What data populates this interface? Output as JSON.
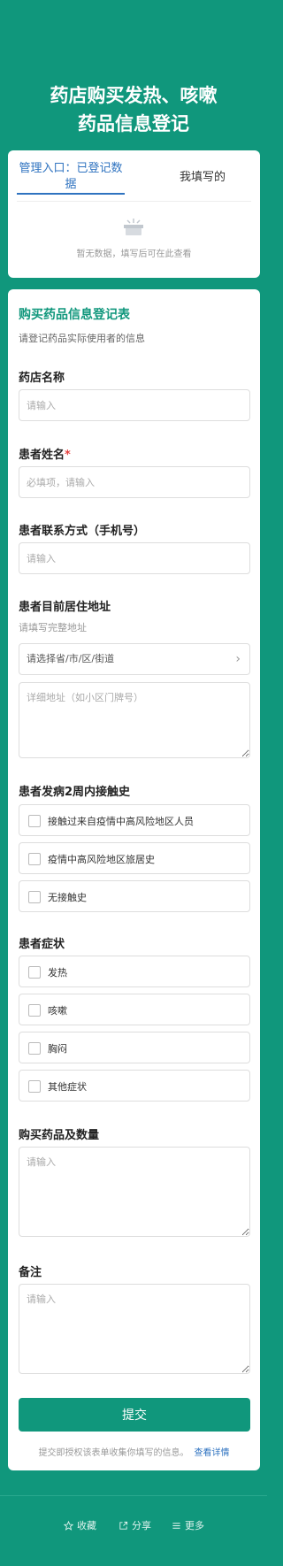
{
  "header": {
    "title_line1": "药店购买发热、咳嗽",
    "title_line2": "药品信息登记"
  },
  "tabs": [
    {
      "label": "管理入口：已登记数据"
    },
    {
      "label": "我填写的"
    }
  ],
  "empty_state": {
    "text": "暂无数据，填写后可在此查看"
  },
  "form": {
    "title": "购买药品信息登记表",
    "description": "请登记药品实际使用者的信息",
    "pharmacy": {
      "label": "药店名称",
      "placeholder": "请输入"
    },
    "patient_name": {
      "label": "患者姓名",
      "required_mark": "*",
      "placeholder": "必填项，请输入"
    },
    "phone": {
      "label": "患者联系方式（手机号）",
      "placeholder": "请输入"
    },
    "address": {
      "label": "患者目前居住地址",
      "hint": "请填写完整地址",
      "region_placeholder": "请选择省/市/区/街道",
      "detail_placeholder": "详细地址（如小区门牌号）"
    },
    "contact_history": {
      "label": "患者发病2周内接触史",
      "options": [
        "接触过来自疫情中高风险地区人员",
        "疫情中高风险地区旅居史",
        "无接触史"
      ]
    },
    "symptoms": {
      "label": "患者症状",
      "options": [
        "发热",
        "咳嗽",
        "胸闷",
        "其他症状"
      ]
    },
    "medicine": {
      "label": "购买药品及数量",
      "placeholder": "请输入"
    },
    "remark": {
      "label": "备注",
      "placeholder": "请输入"
    },
    "submit_label": "提交",
    "consent_text": "提交即授权该表单收集你填写的信息。",
    "consent_link": "查看详情"
  },
  "footer": {
    "favorite": "收藏",
    "share": "分享",
    "more": "更多"
  },
  "colors": {
    "brand": "#10977c",
    "link": "#2f73c0",
    "required": "#e64340"
  }
}
